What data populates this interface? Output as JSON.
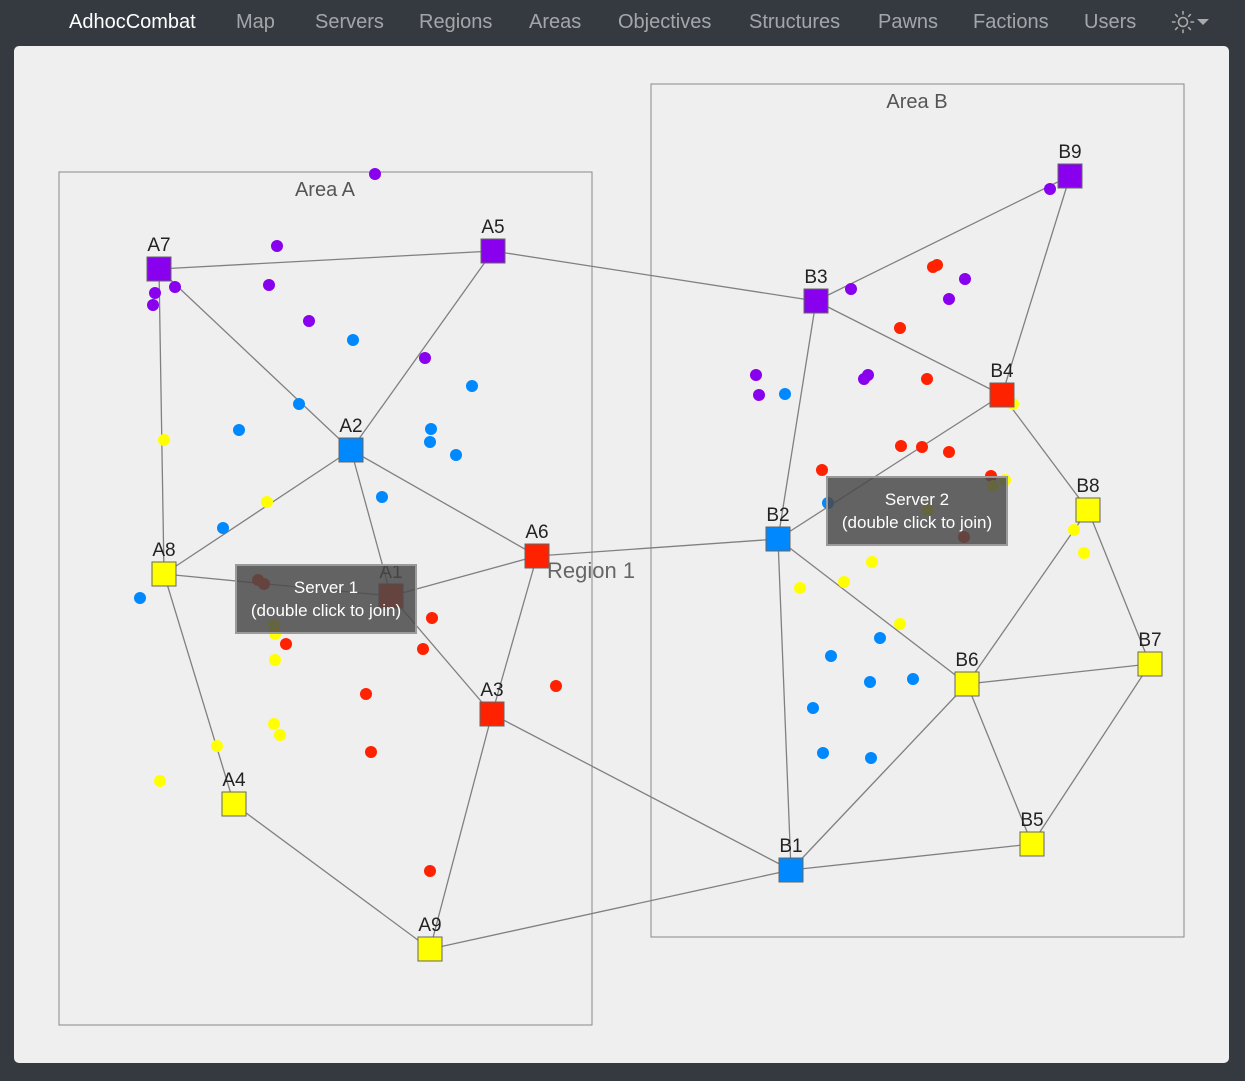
{
  "navbar": {
    "brand": "AdhocCombat",
    "items": [
      "Map",
      "Servers",
      "Regions",
      "Areas",
      "Objectives",
      "Structures",
      "Pawns",
      "Factions",
      "Users"
    ],
    "theme_icon": "sun-icon"
  },
  "colors": {
    "purple": "#8800ee",
    "blue": "#0088ff",
    "red": "#ff2200",
    "yellow": "#ffff00",
    "navbar": "#343a40",
    "map_background": "#efefef"
  },
  "map": {
    "region_label": "Region 1",
    "areas": [
      {
        "name": "Area A"
      },
      {
        "name": "Area B"
      }
    ],
    "objectives": [
      {
        "id": "A1",
        "faction": "red"
      },
      {
        "id": "A2",
        "faction": "blue"
      },
      {
        "id": "A3",
        "faction": "red"
      },
      {
        "id": "A4",
        "faction": "yellow"
      },
      {
        "id": "A5",
        "faction": "purple"
      },
      {
        "id": "A6",
        "faction": "red"
      },
      {
        "id": "A7",
        "faction": "purple"
      },
      {
        "id": "A8",
        "faction": "yellow"
      },
      {
        "id": "A9",
        "faction": "yellow"
      },
      {
        "id": "B1",
        "faction": "blue"
      },
      {
        "id": "B2",
        "faction": "blue"
      },
      {
        "id": "B3",
        "faction": "purple"
      },
      {
        "id": "B4",
        "faction": "red"
      },
      {
        "id": "B5",
        "faction": "yellow"
      },
      {
        "id": "B6",
        "faction": "yellow"
      },
      {
        "id": "B7",
        "faction": "yellow"
      },
      {
        "id": "B8",
        "faction": "yellow"
      },
      {
        "id": "B9",
        "faction": "purple"
      }
    ],
    "connections": [
      [
        "A7",
        "A5"
      ],
      [
        "A7",
        "A8"
      ],
      [
        "A7",
        "A2"
      ],
      [
        "A5",
        "A2"
      ],
      [
        "A5",
        "B3"
      ],
      [
        "A2",
        "A8"
      ],
      [
        "A2",
        "A6"
      ],
      [
        "A2",
        "A1"
      ],
      [
        "A8",
        "A4"
      ],
      [
        "A8",
        "A1"
      ],
      [
        "A1",
        "A6"
      ],
      [
        "A1",
        "A3"
      ],
      [
        "A6",
        "A3"
      ],
      [
        "A6",
        "B2"
      ],
      [
        "A3",
        "A9"
      ],
      [
        "A3",
        "B1"
      ],
      [
        "A4",
        "A9"
      ],
      [
        "A9",
        "B1"
      ],
      [
        "B3",
        "B9"
      ],
      [
        "B3",
        "B4"
      ],
      [
        "B3",
        "B2"
      ],
      [
        "B9",
        "B4"
      ],
      [
        "B4",
        "B2"
      ],
      [
        "B4",
        "B8"
      ],
      [
        "B2",
        "B1"
      ],
      [
        "B2",
        "B6"
      ],
      [
        "B8",
        "B6"
      ],
      [
        "B8",
        "B7"
      ],
      [
        "B6",
        "B7"
      ],
      [
        "B6",
        "B1"
      ],
      [
        "B6",
        "B5"
      ],
      [
        "B7",
        "B5"
      ],
      [
        "B1",
        "B5"
      ]
    ],
    "servers": [
      {
        "name": "Server 1",
        "hint": "(double click to join)"
      },
      {
        "name": "Server 2",
        "hint": "(double click to join)"
      }
    ]
  }
}
